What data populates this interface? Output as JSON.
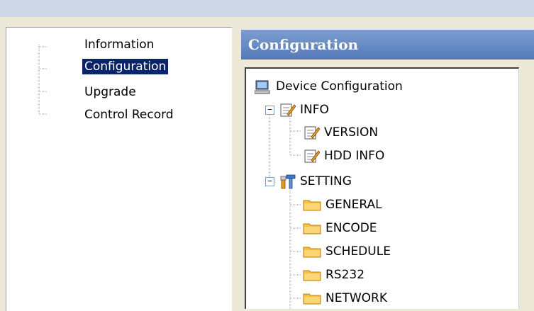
{
  "nav": {
    "items": [
      {
        "label": "Information",
        "selected": false
      },
      {
        "label": "Configuration",
        "selected": true
      },
      {
        "label": "Upgrade",
        "selected": false
      },
      {
        "label": "Control Record",
        "selected": false
      }
    ]
  },
  "config": {
    "title": "Configuration",
    "tree": {
      "root": {
        "label": "Device Configuration",
        "icon": "computer-icon"
      },
      "info": {
        "label": "INFO",
        "icon": "notepad-edit-icon",
        "expanded": true,
        "children": [
          {
            "label": "VERSION",
            "icon": "notepad-edit-icon"
          },
          {
            "label": "HDD INFO",
            "icon": "notepad-edit-icon"
          }
        ]
      },
      "setting": {
        "label": "SETTING",
        "icon": "tools-icon",
        "expanded": true,
        "children": [
          {
            "label": "GENERAL",
            "icon": "folder-icon"
          },
          {
            "label": "ENCODE",
            "icon": "folder-icon"
          },
          {
            "label": "SCHEDULE",
            "icon": "folder-icon"
          },
          {
            "label": "RS232",
            "icon": "folder-icon"
          },
          {
            "label": "NETWORK",
            "icon": "folder-icon"
          }
        ]
      }
    }
  },
  "colors": {
    "selection": "#0a246a",
    "title_bar": "#5479b8",
    "window_bg": "#ece9d8"
  }
}
